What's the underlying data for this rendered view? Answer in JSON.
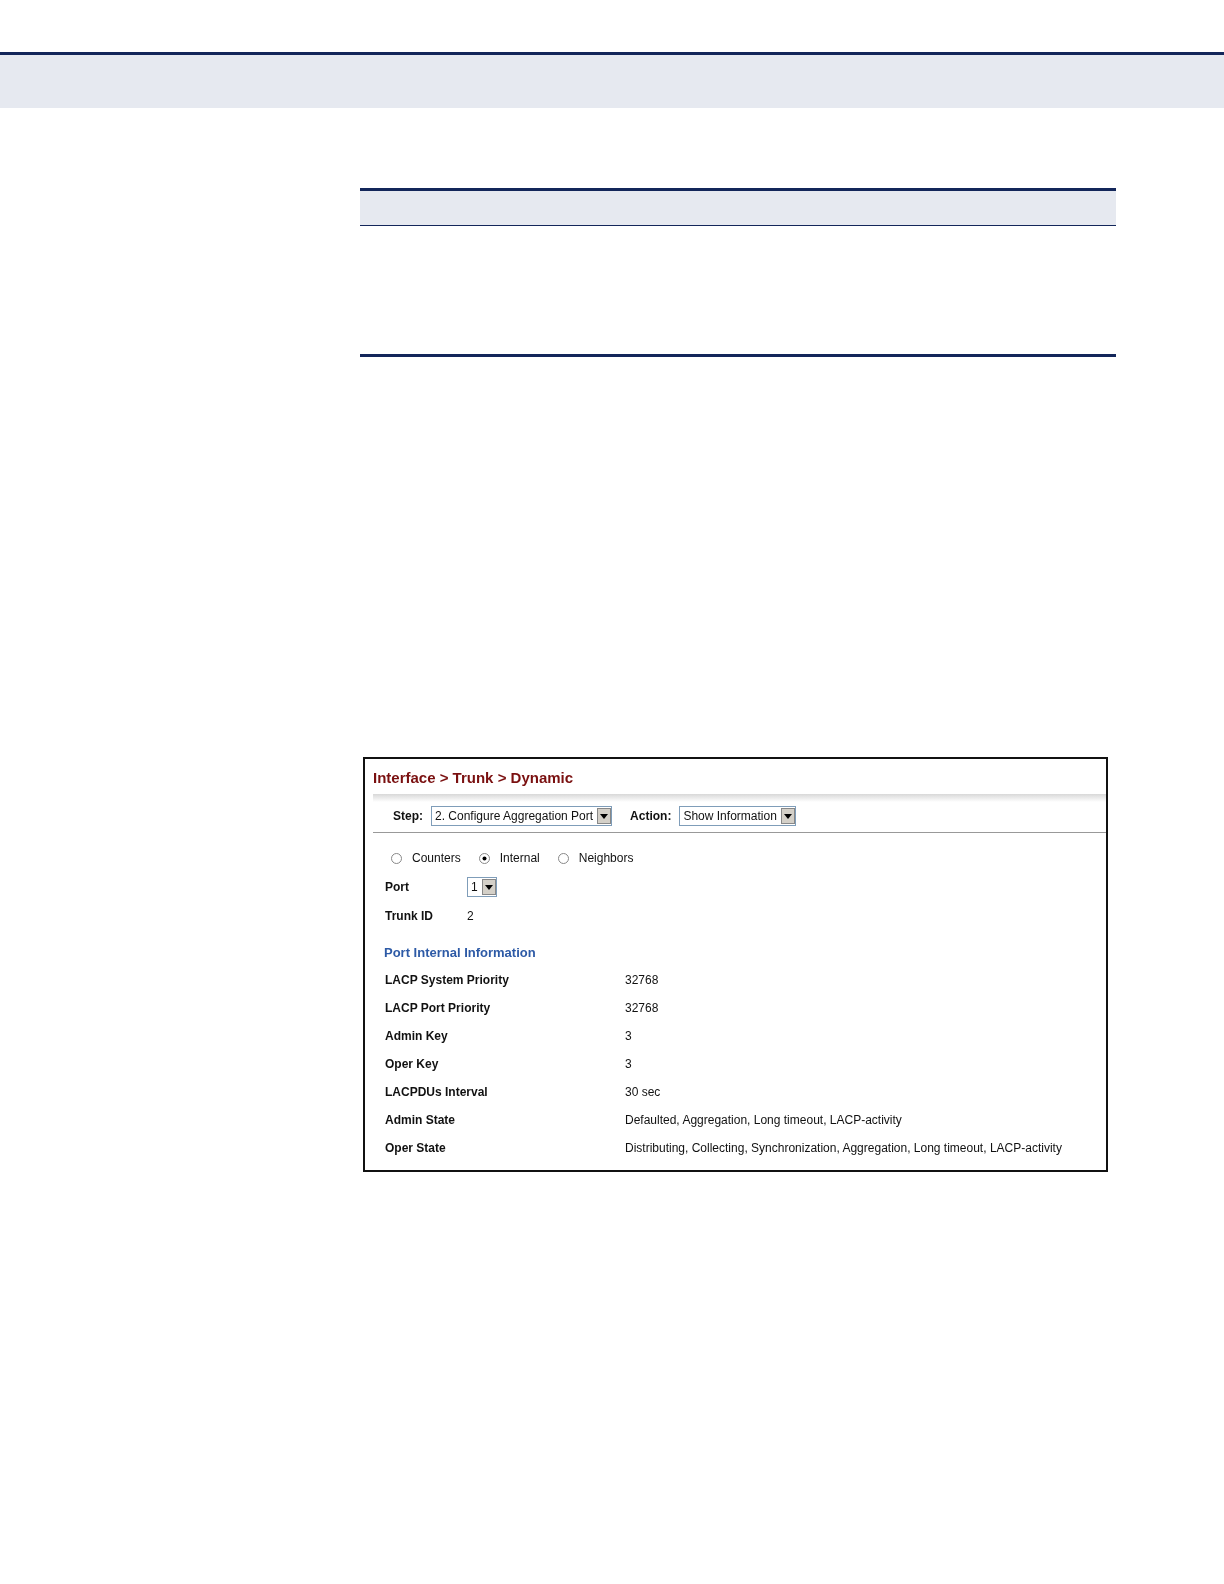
{
  "breadcrumb": "Interface > Trunk > Dynamic",
  "step": {
    "label": "Step:",
    "value": "2. Configure Aggregation Port"
  },
  "action": {
    "label": "Action:",
    "value": "Show Information"
  },
  "views": [
    {
      "label": "Counters",
      "selected": false
    },
    {
      "label": "Internal",
      "selected": true
    },
    {
      "label": "Neighbors",
      "selected": false
    }
  ],
  "port": {
    "label": "Port",
    "value": "1"
  },
  "trunk_id": {
    "label": "Trunk ID",
    "value": "2"
  },
  "section_title": "Port Internal Information",
  "rows": [
    {
      "label": "LACP System Priority",
      "value": "32768"
    },
    {
      "label": "LACP Port Priority",
      "value": "32768"
    },
    {
      "label": "Admin Key",
      "value": "3"
    },
    {
      "label": "Oper Key",
      "value": "3"
    },
    {
      "label": "LACPDUs Interval",
      "value": "30 sec"
    },
    {
      "label": "Admin State",
      "value": "Defaulted, Aggregation, Long timeout, LACP-activity"
    },
    {
      "label": "Oper State",
      "value": "Distributing, Collecting, Synchronization, Aggregation, Long timeout, LACP-activity"
    }
  ]
}
